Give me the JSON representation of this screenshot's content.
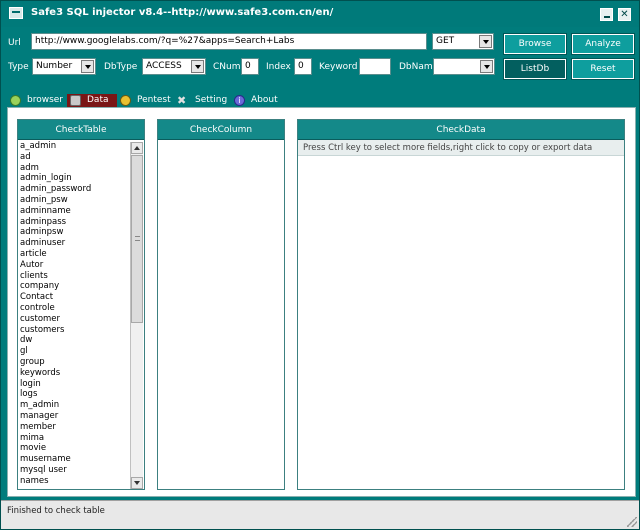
{
  "window": {
    "title": "Safe3 SQL injector v8.4--http://www.safe3.com.cn/en/"
  },
  "form": {
    "url_label": "Url",
    "url_value": "http://www.googlelabs.com/?q=%27&apps=Search+Labs",
    "method_value": "GET",
    "type_label": "Type",
    "type_value": "Number",
    "dbtype_label": "DbType",
    "dbtype_value": "ACCESS",
    "cnum_label": "CNum",
    "cnum_value": "0",
    "index_label": "Index",
    "index_value": "0",
    "keyword_label": "Keyword",
    "keyword_value": "",
    "dbname_label": "DbName",
    "dbname_value": ""
  },
  "buttons": {
    "browse": "Browse",
    "analyze": "Analyze",
    "listdb": "ListDb",
    "reset": "Reset"
  },
  "tabs": [
    {
      "label": "browser",
      "icon": "globe-icon"
    },
    {
      "label": "Data",
      "icon": "database-icon"
    },
    {
      "label": "Pentest",
      "icon": "radiation-icon"
    },
    {
      "label": "Setting",
      "icon": "tools-icon"
    },
    {
      "label": "About",
      "icon": "info-icon"
    }
  ],
  "panels": {
    "check_table": "CheckTable",
    "check_column": "CheckColumn",
    "check_data": "CheckData",
    "check_data_hint": "Press Ctrl key to select more fields,right click to copy or export data"
  },
  "tables": [
    "a_admin",
    "ad",
    "adm",
    "admin_login",
    "admin_password",
    "admin_psw",
    "adminname",
    "adminpass",
    "adminpsw",
    "adminuser",
    "article",
    "Autor",
    "clients",
    "company",
    "Contact",
    "controle",
    "customer",
    "customers",
    "dw",
    "gl",
    "group",
    "keywords",
    "login",
    "logs",
    "m_admin",
    "manager",
    "member",
    "mima",
    "movie",
    "musername",
    "mysql user",
    "names"
  ],
  "status": {
    "text": "Finished to check table"
  },
  "colors": {
    "window_teal": "#007c7c",
    "header_teal": "#148989",
    "active_tab": "#7a1616"
  }
}
